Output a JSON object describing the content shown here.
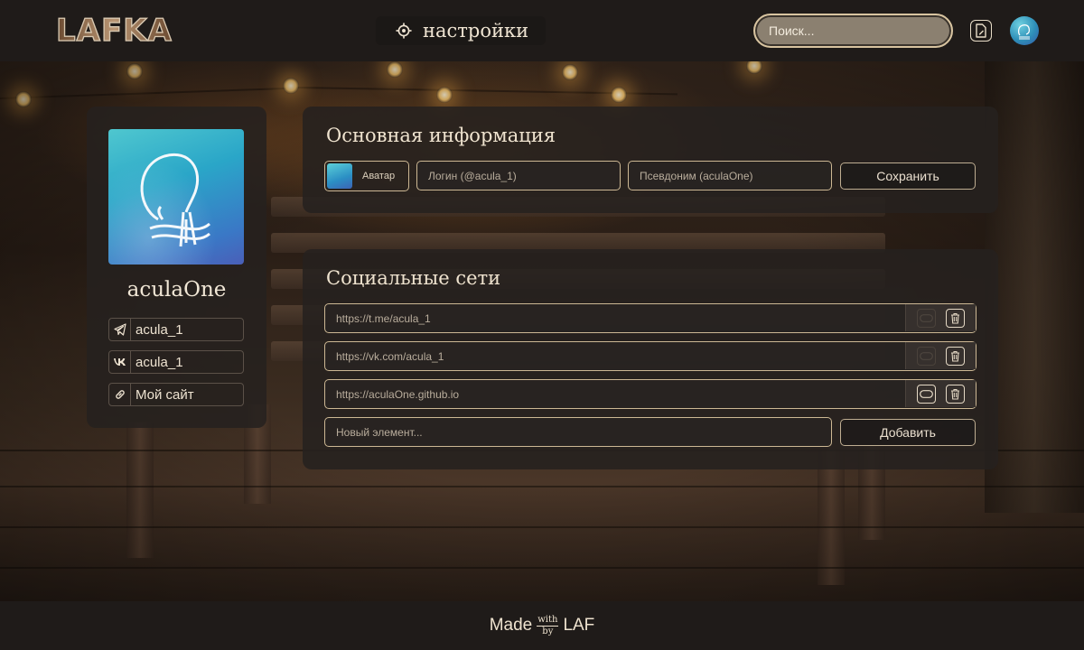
{
  "header": {
    "logo": "LAFKA",
    "page_title": "настройки",
    "search_placeholder": "Поиск..."
  },
  "profile": {
    "nickname": "aculaOne",
    "socials": [
      {
        "icon": "telegram-icon",
        "text": "acula_1"
      },
      {
        "icon": "vk-icon",
        "text": "acula_1"
      },
      {
        "icon": "link-icon",
        "text": "Мой сайт"
      }
    ]
  },
  "basic_info": {
    "title": "Основная информация",
    "avatar_label": "Аватар",
    "login_placeholder": "Логин (@acula_1)",
    "alias_placeholder": "Псевдоним (aculaOne)",
    "save_label": "Сохранить"
  },
  "social_networks": {
    "title": "Социальные сети",
    "links": [
      {
        "url": "https://t.me/acula_1",
        "pill_active": false
      },
      {
        "url": "https://vk.com/acula_1",
        "pill_active": false
      },
      {
        "url": "https://aculaOne.github.io",
        "pill_active": true
      }
    ],
    "new_placeholder": "Новый элемент...",
    "add_label": "Добавить"
  },
  "footer": {
    "made": "Made",
    "with": "with",
    "by": "by",
    "laf": "LAF"
  },
  "colors": {
    "accent_border": "#cdb894",
    "panel": "#25211f",
    "header": "#1f1b19",
    "text": "#eadfcf"
  }
}
